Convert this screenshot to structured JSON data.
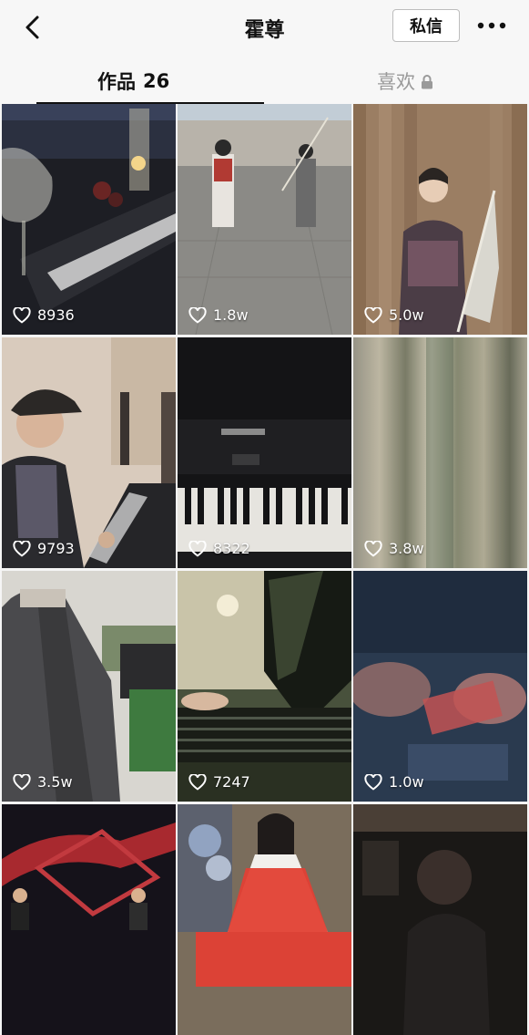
{
  "header": {
    "title": "霍尊",
    "message_button": "私信"
  },
  "tabs": {
    "works_label": "作品",
    "works_count": "26",
    "likes_label": "喜欢"
  },
  "videos": [
    {
      "likes": "8936",
      "scene": "keyboard with wine glass at night"
    },
    {
      "likes": "1.8w",
      "scene": "opera performers on square"
    },
    {
      "likes": "5.0w",
      "scene": "man in plaid shirt with umbrella"
    },
    {
      "likes": "9793",
      "scene": "man in cap playing keyboard"
    },
    {
      "likes": "8322",
      "scene": "upright piano keys"
    },
    {
      "likes": "3.8w",
      "scene": "blurred curtain"
    },
    {
      "likes": "3.5w",
      "scene": "coat hanging indoors"
    },
    {
      "likes": "7247",
      "scene": "hands on piano keys"
    },
    {
      "likes": "1.0w",
      "scene": "blurred hands"
    },
    {
      "likes": "",
      "scene": "stage with red structure"
    },
    {
      "likes": "",
      "scene": "woman in red dress"
    },
    {
      "likes": "",
      "scene": "dim indoor person"
    }
  ],
  "colors": {
    "topbar_bg": "#f7f7f7",
    "text_primary": "#111111",
    "text_muted": "#9a9a9a"
  },
  "icons": {
    "back": "chevron-left-icon",
    "more": "more-dots-icon",
    "lock": "lock-icon",
    "like": "heart-outline-icon"
  }
}
